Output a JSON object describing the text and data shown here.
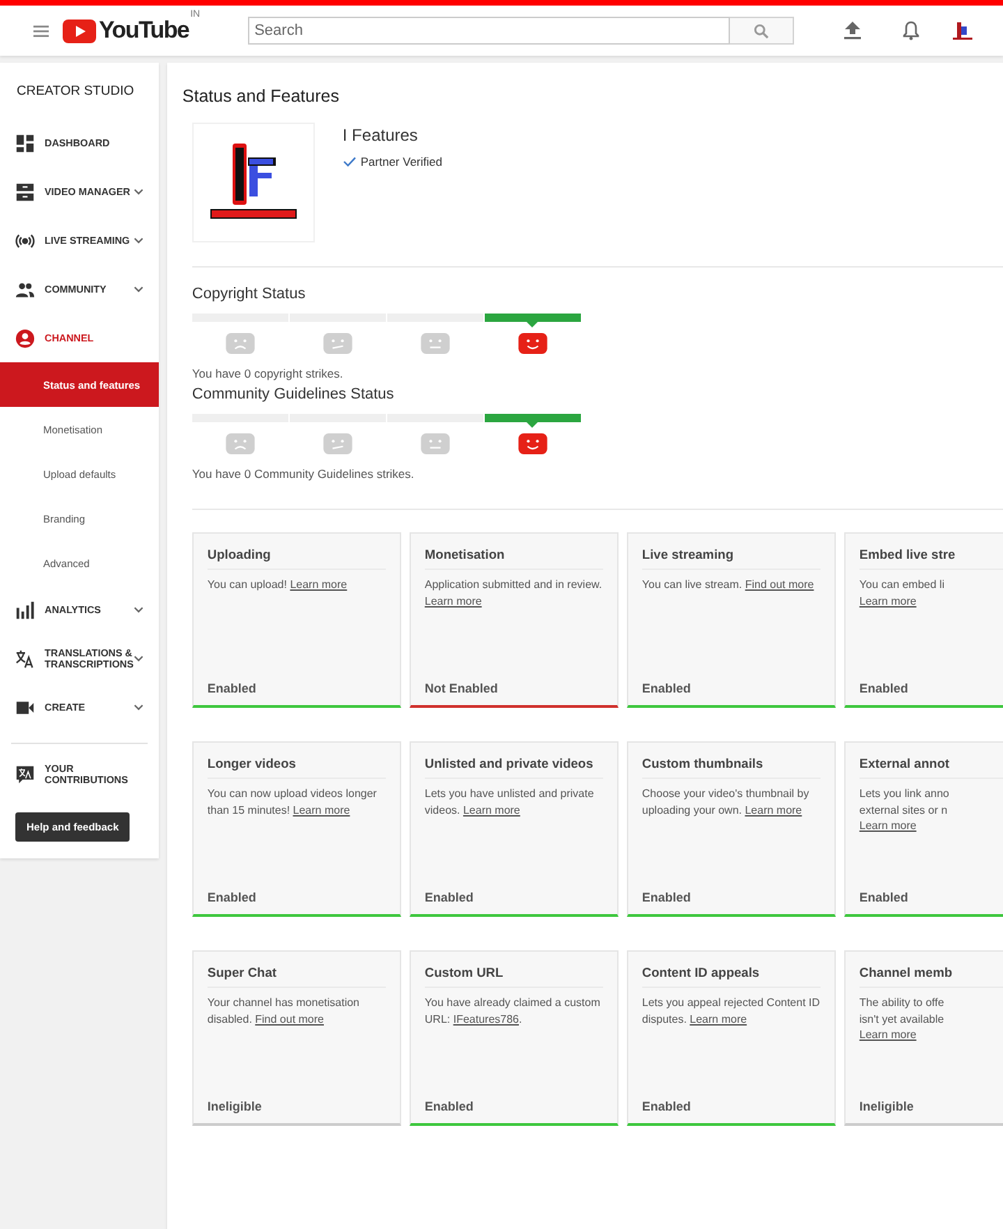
{
  "header": {
    "logo_text": "YouTube",
    "region": "IN",
    "search": {
      "placeholder": "Search"
    }
  },
  "sidebar": {
    "title": "CREATOR STUDIO",
    "items": [
      {
        "kind": "dashboard",
        "label": "DASHBOARD",
        "selected": false
      },
      {
        "kind": "videos",
        "label": "VIDEO MANAGER",
        "selected": false,
        "expanded": false
      },
      {
        "kind": "live",
        "label": "LIVE STREAMING",
        "selected": false,
        "expanded": false
      },
      {
        "kind": "community",
        "label": "COMMUNITY",
        "selected": false,
        "expanded": false
      },
      {
        "kind": "channel",
        "label": "CHANNEL",
        "selected": true,
        "expanded": true,
        "children": [
          {
            "label": "Status and features",
            "selected": true
          },
          {
            "label": "Monetisation",
            "selected": false
          },
          {
            "label": "Upload defaults",
            "selected": false
          },
          {
            "label": "Branding",
            "selected": false
          },
          {
            "label": "Advanced",
            "selected": false
          }
        ]
      },
      {
        "kind": "analytics",
        "label": "ANALYTICS",
        "selected": false,
        "expanded": false
      },
      {
        "kind": "translations",
        "label": "TRANSLATIONS & TRANSCRIPTIONS",
        "selected": false,
        "expanded": false
      },
      {
        "kind": "create",
        "label": "CREATE",
        "selected": false,
        "expanded": false
      }
    ],
    "contributions": "YOUR CONTRIBUTIONS",
    "help_button": "Help and feedback"
  },
  "page": {
    "title": "Status and Features",
    "channel": {
      "name": "I Features",
      "badge": "Partner Verified"
    },
    "statuses": [
      {
        "title": "Copyright Status",
        "segments": [
          {
            "selected": false
          },
          {
            "selected": false
          },
          {
            "selected": false
          },
          {
            "selected": true
          }
        ],
        "note": "You have 0 copyright strikes."
      },
      {
        "title": "Community Guidelines Status",
        "segments": [
          {
            "selected": false
          },
          {
            "selected": false
          },
          {
            "selected": false
          },
          {
            "selected": true
          }
        ],
        "note": "You have 0 Community Guidelines strikes."
      }
    ],
    "features": [
      {
        "title": "Uploading",
        "description": "You can upload! ",
        "link": "Learn more",
        "status": "Enabled",
        "kind": "on"
      },
      {
        "title": "Monetisation",
        "description": "Application submitted and in review. ",
        "link": "Learn more",
        "status": "Not Enabled",
        "kind": "off"
      },
      {
        "title": "Live streaming",
        "description": "You can live stream. ",
        "link": "Find out more",
        "status": "Enabled",
        "kind": "on"
      },
      {
        "title": "Embed live stre",
        "lines": [
          "You can embed li"
        ],
        "link": "Learn more",
        "status": "Enabled",
        "kind": "on"
      },
      {
        "title": "Longer videos",
        "description": "You can now upload videos longer than 15 minutes! ",
        "link": "Learn more",
        "status": "Enabled",
        "kind": "on"
      },
      {
        "title": "Unlisted and private videos",
        "description": "Lets you have unlisted and private videos. ",
        "link": "Learn more",
        "status": "Enabled",
        "kind": "on"
      },
      {
        "title": "Custom thumbnails",
        "description": "Choose your video's thumbnail by uploading your own. ",
        "link": "Learn more",
        "status": "Enabled",
        "kind": "on"
      },
      {
        "title": "External annot",
        "lines": [
          "Lets you link anno",
          "external sites or n"
        ],
        "link": "Learn more",
        "status": "Enabled",
        "kind": "on"
      },
      {
        "title": "Super Chat",
        "description": "Your channel has monetisation disabled. ",
        "link": "Find out more",
        "status": "Ineligible",
        "kind": "na"
      },
      {
        "title": "Custom URL",
        "description": "You have already claimed a custom URL: ",
        "link": "IFeatures786",
        "after": ".",
        "status": "Enabled",
        "kind": "on"
      },
      {
        "title": "Content ID appeals",
        "description": "Lets you appeal rejected Content ID disputes. ",
        "link": "Learn more",
        "status": "Enabled",
        "kind": "on"
      },
      {
        "title": "Channel memb",
        "lines": [
          "The ability to offe",
          "isn't yet available"
        ],
        "link": "Learn more",
        "status": "Ineligible",
        "kind": "na"
      }
    ]
  }
}
